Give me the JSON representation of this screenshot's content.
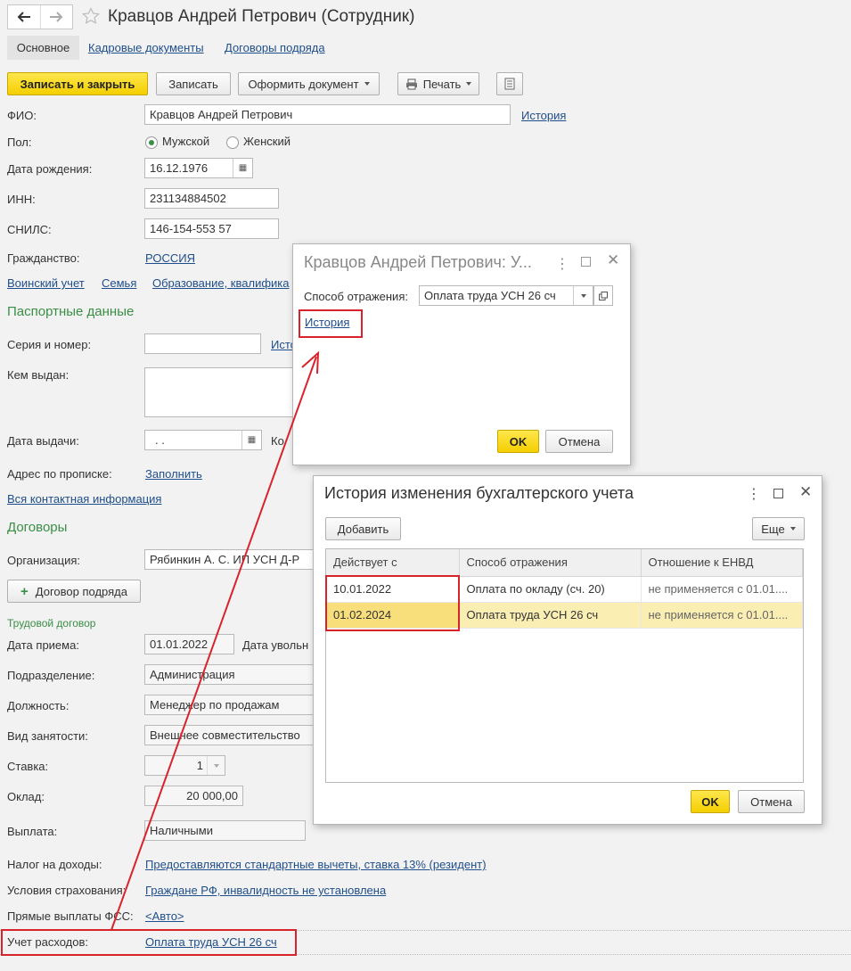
{
  "window": {
    "title": "Кравцов Андрей Петрович (Сотрудник)"
  },
  "tabs": [
    "Основное",
    "Кадровые документы",
    "Договоры подряда"
  ],
  "toolbar": {
    "save_close": "Записать и закрыть",
    "save": "Записать",
    "make_doc": "Оформить документ",
    "print": "Печать"
  },
  "form": {
    "fio_label": "ФИО:",
    "fio_value": "Кравцов Андрей Петрович",
    "history_link": "История",
    "gender_label": "Пол:",
    "gender_male": "Мужской",
    "gender_female": "Женский",
    "birth_label": "Дата рождения:",
    "birth_value": "16.12.1976",
    "inn_label": "ИНН:",
    "inn_value": "231134884502",
    "snils_label": "СНИЛС:",
    "snils_value": "146-154-553 57",
    "citizenship_label": "Гражданство:",
    "citizenship_value": "РОССИЯ",
    "links": [
      "Воинский учет",
      "Семья",
      "Образование, квалифика"
    ],
    "passport_section": "Паспортные данные",
    "passport_series_label": "Серия и номер:",
    "passport_history_cut": "Исто",
    "issued_by_label": "Кем выдан:",
    "issue_date_label": "Дата выдачи:",
    "issue_date_value": ". .",
    "code_cut": "Ко",
    "address_label": "Адрес по прописке:",
    "address_link": "Заполнить",
    "contact_link": "Вся контактная информация",
    "contracts_section": "Договоры",
    "org_label": "Организация:",
    "org_value": "Рябинкин А. С. ИП УСН Д-Р",
    "contract_button": "Договор подряда",
    "labor_contract": "Трудовой договор",
    "hire_label": "Дата приема:",
    "hire_value": "01.01.2022",
    "dismiss_label": "Дата увольн",
    "dept_label": "Подразделение:",
    "dept_value": "Администрация",
    "position_label": "Должность:",
    "position_value": "Менеджер по продажам",
    "employment_label": "Вид занятости:",
    "employment_value": "Внешнее совместительство",
    "rate_label": "Ставка:",
    "rate_value": "1",
    "salary_label": "Оклад:",
    "salary_value": "20 000,00",
    "payment_label": "Выплата:",
    "payment_value": "Наличными",
    "tax_label": "Налог на доходы:",
    "tax_value": "Предоставляются стандартные вычеты, ставка 13% (резидент)",
    "insurance_label": "Условия страхования:",
    "insurance_value": "Граждане РФ, инвалидность не установлена",
    "fss_label": "Прямые выплаты ФСС:",
    "fss_value": "<Авто>",
    "expense_label": "Учет расходов:",
    "expense_value": "Оплата труда УСН 26 сч"
  },
  "dialog1": {
    "title": "Кравцов Андрей Петрович: У...",
    "method_label": "Способ отражения:",
    "method_value": "Оплата труда УСН 26 сч",
    "history_link": "История",
    "ok": "OK",
    "cancel": "Отмена"
  },
  "dialog2": {
    "title": "История изменения бухгалтерского учета",
    "add": "Добавить",
    "more": "Еще",
    "columns": [
      "Действует с",
      "Способ отражения",
      "Отношение к ЕНВД"
    ],
    "rows": [
      [
        "10.01.2022",
        "Оплата по окладу (сч. 20)",
        "не применяется с 01.01...."
      ],
      [
        "01.02.2024",
        "Оплата труда УСН 26 сч",
        "не применяется с 01.01...."
      ]
    ],
    "ok": "OK",
    "cancel": "Отмена"
  },
  "colors": {
    "accent_yellow": "#f4cf00",
    "section_green": "#3a8f46",
    "link_blue": "#1f4e8c",
    "highlight_red": "#d9232b",
    "selected_row": "#fbeeb3"
  }
}
